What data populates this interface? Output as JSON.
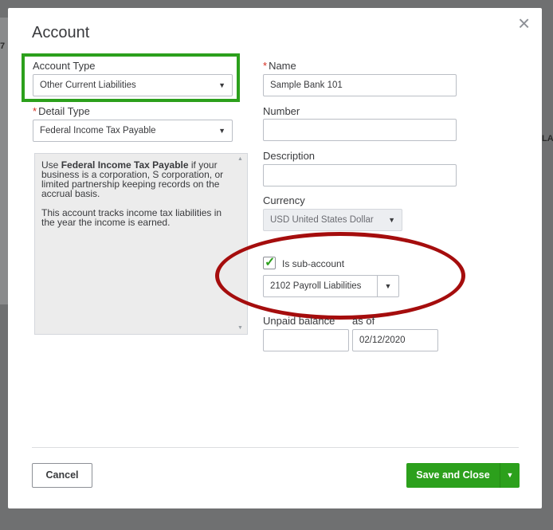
{
  "background": {
    "left_fragment": "7",
    "right_fragment": "LAN"
  },
  "dialog": {
    "title": "Account",
    "close_glyph": "×"
  },
  "account_type": {
    "label": "Account Type",
    "value": "Other Current Liabilities"
  },
  "detail_type": {
    "label": "Detail Type",
    "value": "Federal Income Tax Payable"
  },
  "description_panel": {
    "para1_prefix": "Use ",
    "para1_bold": "Federal Income Tax Payable",
    "para1_suffix": " if your business is a corporation, S corporation, or limited partnership keeping records on the accrual basis.",
    "para2": "This account tracks income tax liabilities in the year the income is earned."
  },
  "name_field": {
    "label": "Name",
    "value": "Sample Bank 101"
  },
  "number_field": {
    "label": "Number",
    "value": ""
  },
  "description_field": {
    "label": "Description",
    "value": ""
  },
  "currency": {
    "label": "Currency",
    "value": "USD United States Dollar"
  },
  "sub_account": {
    "label": "Is sub-account",
    "checked": true,
    "parent_value": "2102 Payroll Liabilities"
  },
  "unpaid_balance": {
    "label": "Unpaid balance",
    "value": "",
    "as_of_label": "as of",
    "as_of_value": "02/12/2020"
  },
  "footer": {
    "cancel_label": "Cancel",
    "save_label": "Save and Close"
  },
  "colors": {
    "accent_green": "#2ca01c",
    "highlight_red": "#a50d0d",
    "required_red": "#d52b1e"
  },
  "icons": {
    "close": "close-icon",
    "caret": "chevron-down-icon",
    "check": "check-icon"
  }
}
